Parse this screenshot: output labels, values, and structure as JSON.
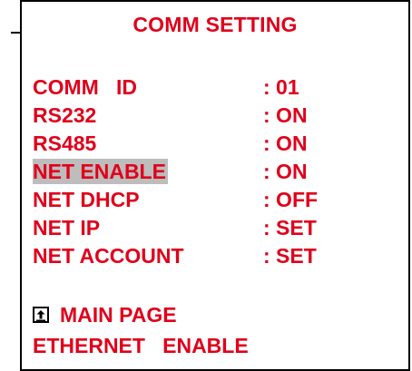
{
  "screen": {
    "title": "COMM SETTING",
    "accent_color": "#e0001b",
    "highlight_color": "#bdbdbd"
  },
  "settings": [
    {
      "label": "COMM   ID",
      "value": ": 01",
      "selected": false
    },
    {
      "label": "RS232",
      "value": ": ON",
      "selected": false
    },
    {
      "label": "RS485",
      "value": ": ON",
      "selected": false
    },
    {
      "label": "NET ENABLE",
      "value": ": ON",
      "selected": true
    },
    {
      "label": "NET DHCP",
      "value": ": OFF",
      "selected": false
    },
    {
      "label": "NET IP",
      "value": ": SET",
      "selected": false
    },
    {
      "label": "NET ACCOUNT",
      "value": ": SET",
      "selected": false
    }
  ],
  "footer": {
    "main_page_icon": "return-up-icon",
    "main_page_label": "MAIN PAGE",
    "status_text": "ETHERNET   ENABLE"
  }
}
